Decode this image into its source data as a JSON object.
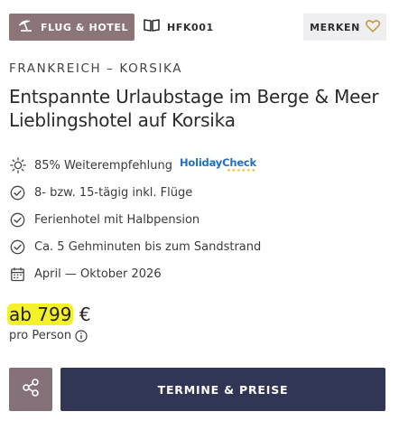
{
  "header": {
    "badge_label": "FLUG & HOTEL",
    "badge_icon": "beach-umbrella-icon",
    "code_label": "HFK001",
    "code_icon": "book-icon",
    "merken_label": "MERKEN",
    "merken_icon": "heart-outline-icon"
  },
  "region": "FRANKREICH – KORSIKA",
  "title_line1": "Entspannte Urlaubstage im Berge & Meer",
  "title_line2": "Lieblingshotel auf Korsika",
  "features": [
    {
      "icon": "sun-icon",
      "text": "85% Weiterempfehlung",
      "logo": "HolidayCheck"
    },
    {
      "icon": "check-circle-icon",
      "text": "8- bzw. 15-tägig inkl. Flüge"
    },
    {
      "icon": "check-circle-icon",
      "text": "Ferienhotel mit Halbpension"
    },
    {
      "icon": "check-circle-icon",
      "text": "Ca. 5 Gehminuten bis zum Sandstrand"
    },
    {
      "icon": "calendar-icon",
      "text": "April — Oktober 2026"
    }
  ],
  "price": {
    "highlighted": "ab 799",
    "currency": "€",
    "per_person": "pro Person"
  },
  "actions": {
    "share_icon": "share-icon",
    "cta_label": "TERMINE & PREISE"
  },
  "colors": {
    "badge_bg": "#8b7579",
    "share_bg": "#85717a",
    "cta_bg": "#313654",
    "highlight": "#f4f02a",
    "holidaycheck_blue": "#1e6fc8"
  }
}
